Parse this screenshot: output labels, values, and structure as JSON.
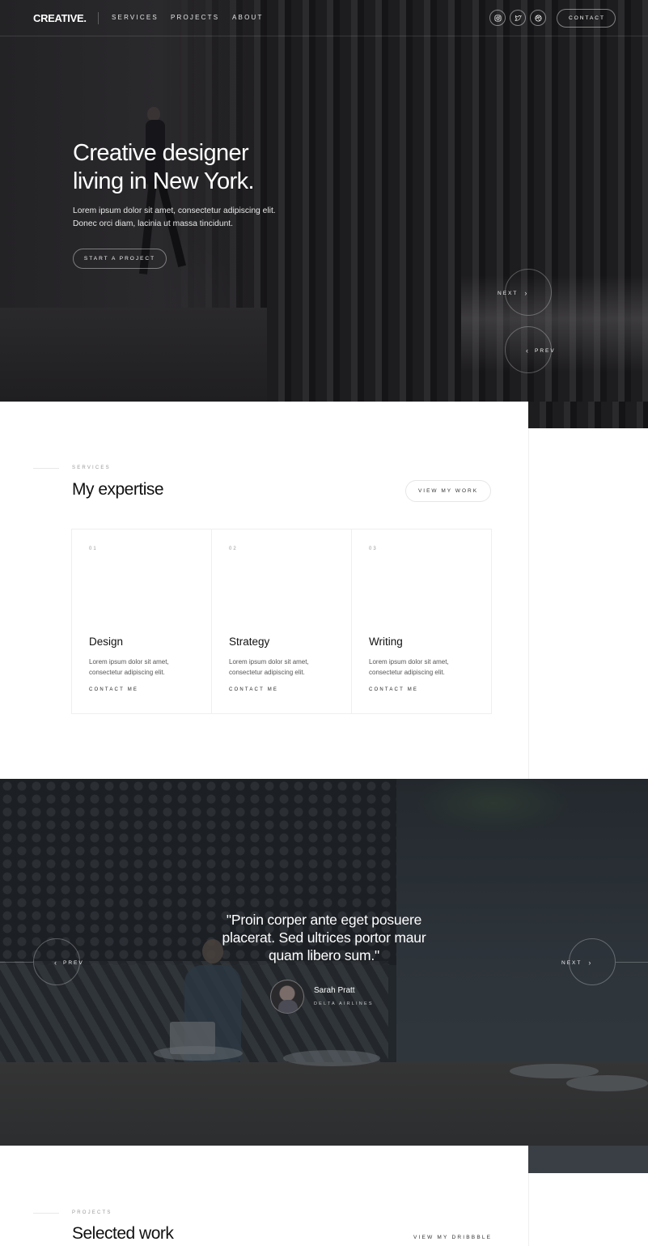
{
  "brand": "CREATIVE.",
  "nav": {
    "links": [
      "SERVICES",
      "PROJECTS",
      "ABOUT"
    ],
    "social": [
      "instagram-icon",
      "twitter-icon",
      "dribbble-icon"
    ],
    "contact_label": "CONTACT"
  },
  "hero": {
    "title_line1": "Creative designer",
    "title_line2": "living in New York.",
    "text": "Lorem ipsum dolor sit amet, consectetur adipiscing elit. Donec orci diam, lacinia ut massa tincidunt.",
    "cta_label": "START A PROJECT",
    "next_label": "NEXT",
    "prev_label": "PREV"
  },
  "services": {
    "eyebrow": "SERVICES",
    "title": "My expertise",
    "view_work_label": "VIEW MY WORK",
    "cards": [
      {
        "num": "01",
        "title": "Design",
        "text": "Lorem ipsum dolor sit amet, consectetur adipiscing elit.",
        "link": "CONTACT ME"
      },
      {
        "num": "02",
        "title": "Strategy",
        "text": "Lorem ipsum dolor sit amet, consectetur adipiscing elit.",
        "link": "CONTACT ME"
      },
      {
        "num": "03",
        "title": "Writing",
        "text": "Lorem ipsum dolor sit amet, consectetur adipiscing elit.",
        "link": "CONTACT ME"
      }
    ]
  },
  "testimonial": {
    "quote_line1": "\"Proin corper ante eget posuere",
    "quote_line2": "placerat. Sed ultrices portor maur",
    "quote_line3": "quam libero sum.\"",
    "author": "Sarah Pratt",
    "company": "DELTA AIRLINES",
    "prev_label": "PREV",
    "next_label": "NEXT"
  },
  "projects": {
    "eyebrow": "PROJECTS",
    "title": "Selected work",
    "dribbble_label": "VIEW MY DRIBBBLE"
  }
}
